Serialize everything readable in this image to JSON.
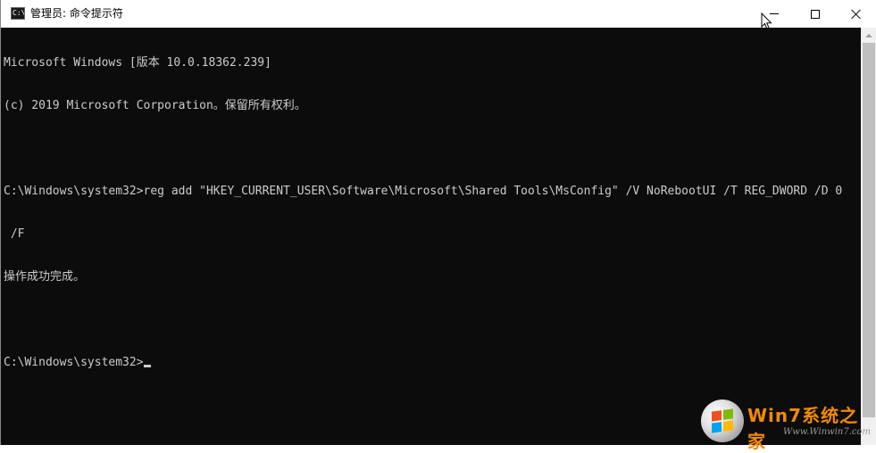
{
  "window": {
    "title": "管理员: 命令提示符",
    "icon_text": "C:\\"
  },
  "console": {
    "lines": [
      "Microsoft Windows [版本 10.0.18362.239]",
      "(c) 2019 Microsoft Corporation。保留所有权利。",
      "",
      "C:\\Windows\\system32>reg add \"HKEY_CURRENT_USER\\Software\\Microsoft\\Shared Tools\\MsConfig\" /V NoRebootUI /T REG_DWORD /D 0",
      " /F",
      "操作成功完成。",
      "",
      "C:\\Windows\\system32>"
    ]
  },
  "watermark": {
    "title": "Win7系统之家",
    "url": "Www.Winwin7.com"
  },
  "icons": {
    "minimize": "minimize-icon",
    "maximize": "maximize-icon",
    "close": "close-icon",
    "app": "cmd-icon"
  },
  "colors": {
    "console_bg": "#0c0c0c",
    "console_text": "#cccccc",
    "watermark_orange": "#f28a00"
  }
}
